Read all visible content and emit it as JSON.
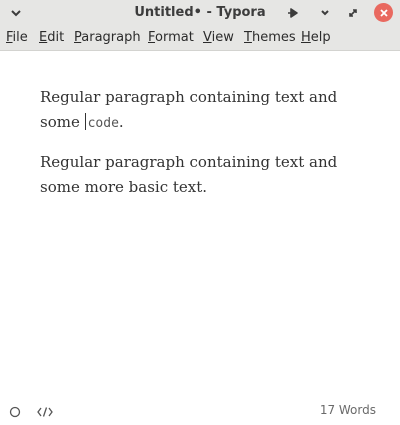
{
  "window": {
    "title": "Untitled• - Typora"
  },
  "menubar": {
    "items": [
      {
        "mnemonic": "F",
        "rest": "ile"
      },
      {
        "mnemonic": "E",
        "rest": "dit"
      },
      {
        "mnemonic": "P",
        "rest": "aragraph"
      },
      {
        "mnemonic": "F",
        "rest": "ormat"
      },
      {
        "mnemonic": "V",
        "rest": "iew"
      },
      {
        "mnemonic": "T",
        "rest": "hemes"
      },
      {
        "mnemonic": "H",
        "rest": "elp"
      }
    ]
  },
  "editor": {
    "paragraphs": [
      {
        "text_before": "Regular paragraph containing text and some ",
        "code": "code",
        "text_after": "."
      },
      {
        "text": "Regular paragraph containing text and some more basic text."
      }
    ]
  },
  "statusbar": {
    "word_count": "17 Words",
    "icons": [
      "outline-toggle-icon",
      "source-code-mode-icon"
    ]
  },
  "colors": {
    "titlebar_bg": "#e6e6e4",
    "close_button": "#e9695f",
    "text": "#333333"
  }
}
